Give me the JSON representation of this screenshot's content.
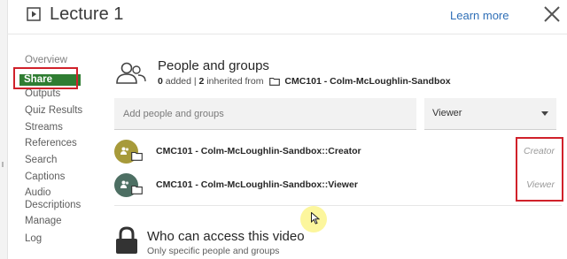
{
  "header": {
    "title": "Lecture 1",
    "learn_more": "Learn more",
    "icons": {
      "title": "play-box-icon",
      "close": "close-icon"
    }
  },
  "sidebar": {
    "items": [
      {
        "label": "Overview",
        "state": "partially-hidden"
      },
      {
        "label": "Share",
        "state": "selected"
      },
      {
        "label": "Outputs"
      },
      {
        "label": "Quiz Results"
      },
      {
        "label": "Streams"
      },
      {
        "label": "References"
      },
      {
        "label": "Search"
      },
      {
        "label": "Captions"
      },
      {
        "label": "Audio Descriptions"
      },
      {
        "label": "Manage"
      },
      {
        "label": "Log"
      }
    ],
    "selected_color": "#2f7d32"
  },
  "people": {
    "title": "People and groups",
    "added_count": "0",
    "added_text": "added",
    "separator": "|",
    "inherited_count": "2",
    "inherited_text": "inherited from",
    "folder_name": "CMC101 - Colm-McLoughlin-Sandbox",
    "add_placeholder": "Add people and groups",
    "role_selected": "Viewer",
    "rows": [
      {
        "name": "CMC101 - Colm-McLoughlin-Sandbox::Creator",
        "role": "Creator",
        "avatar_color": "#a79a3a"
      },
      {
        "name": "CMC101 - Colm-McLoughlin-Sandbox::Viewer",
        "role": "Viewer",
        "avatar_color": "#4d6f63"
      }
    ]
  },
  "access": {
    "title": "Who can access this video",
    "subtitle": "Only specific people and groups"
  },
  "colors": {
    "accent_link": "#2f6fb7",
    "highlight_box": "#d0212a",
    "cursor_halo": "#fbf58c"
  }
}
